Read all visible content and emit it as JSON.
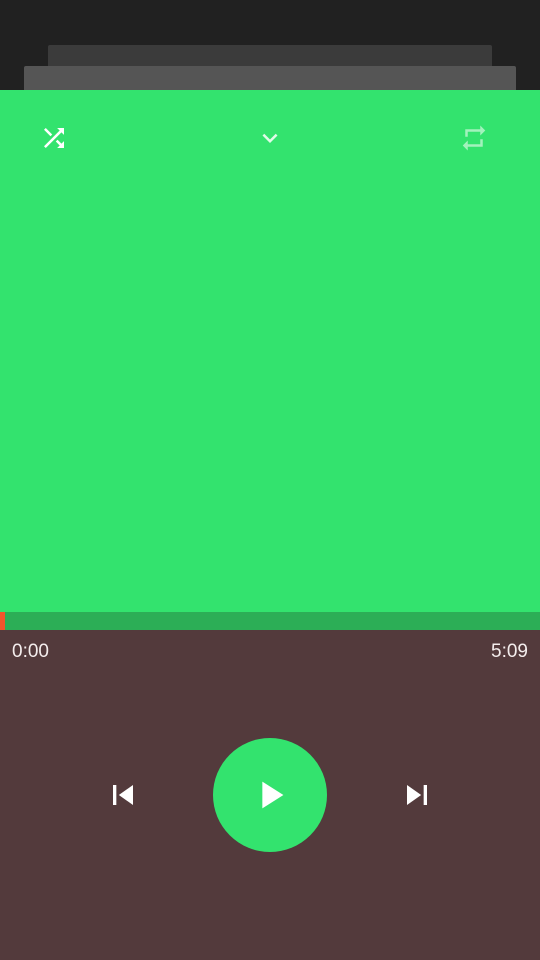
{
  "player": {
    "elapsed": "0:00",
    "duration": "5:09",
    "progress_fraction": 0.01
  },
  "colors": {
    "artwork_background": "#33e36e",
    "progress_track": "#2cae56",
    "progress_fill": "#f2552c",
    "controls_background": "#533a3c",
    "play_button": "#33e36e"
  },
  "icons": {
    "shuffle": "shuffle-icon",
    "collapse": "chevron-down-icon",
    "repeat": "repeat-icon",
    "previous": "skip-previous-icon",
    "play": "play-icon",
    "next": "skip-next-icon"
  }
}
